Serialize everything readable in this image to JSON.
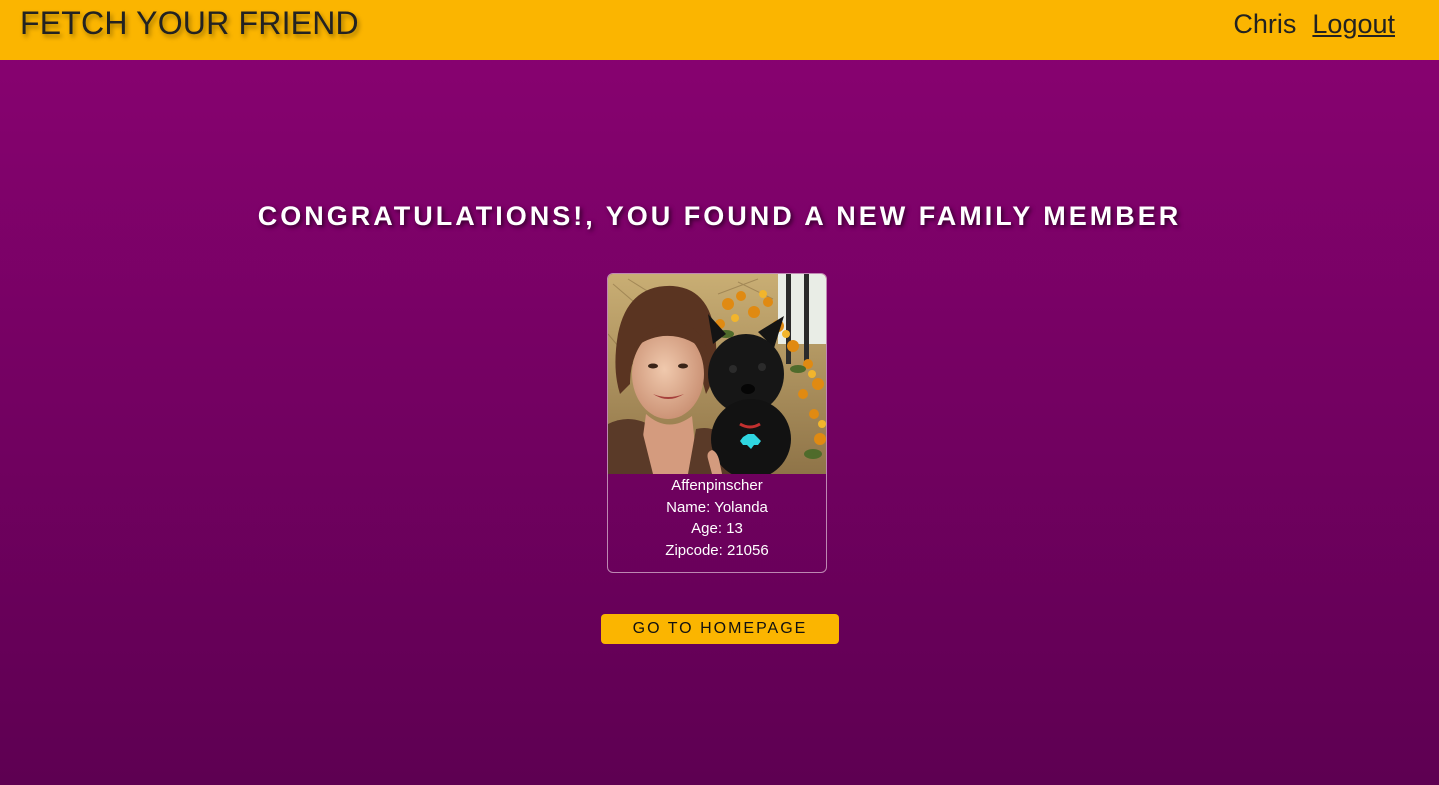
{
  "header": {
    "brand": "FETCH YOUR FRIEND",
    "user": "Chris",
    "logout": "Logout"
  },
  "main": {
    "heading": "CONGRATULATIONS!, YOU FOUND A NEW FAMILY MEMBER",
    "pet": {
      "breed": "Affenpinscher",
      "name": "Name: Yolanda",
      "age": "Age: 13",
      "zipcode": "Zipcode: 21056"
    },
    "home_button": "GO TO HOMEPAGE"
  },
  "colors": {
    "header_bg": "#fbb500",
    "page_gradient_top": "#8a0272",
    "page_gradient_bottom": "#5e0052",
    "button_bg": "#fbb500",
    "text_light": "#ffffff"
  }
}
